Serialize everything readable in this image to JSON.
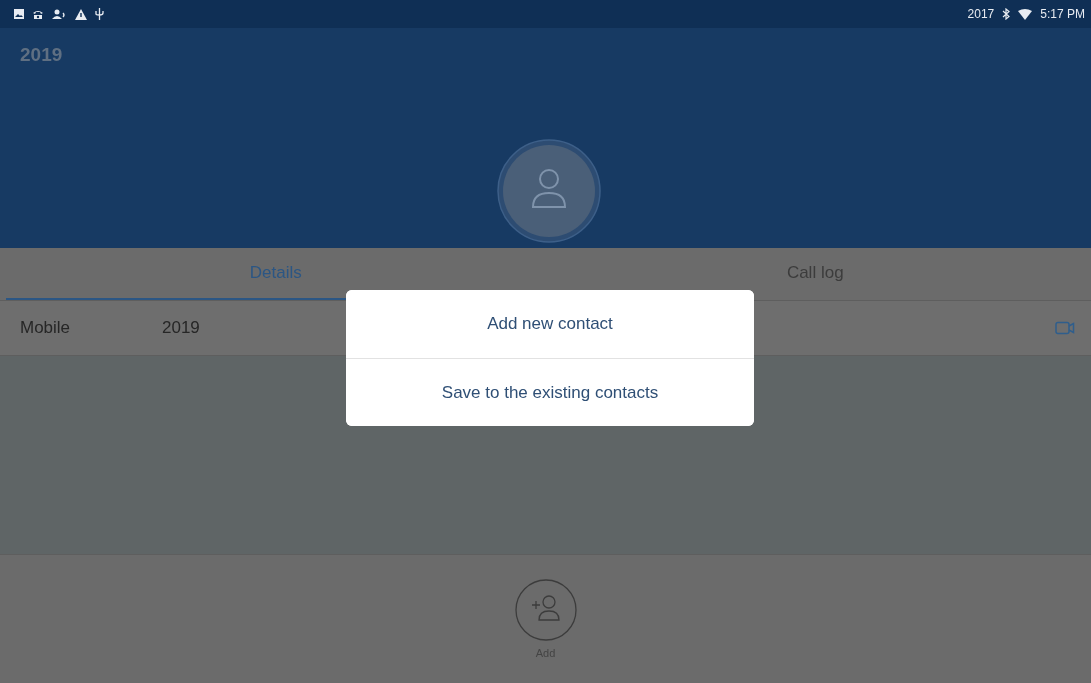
{
  "status_bar": {
    "left_text": "2017",
    "time": "5:17 PM"
  },
  "header": {
    "title": "2019"
  },
  "tabs": [
    {
      "label": "Details",
      "selected": true
    },
    {
      "label": "Call log",
      "selected": false
    }
  ],
  "details": [
    {
      "label": "Mobile",
      "value": "2019"
    }
  ],
  "bottom_bar": {
    "add_label": "Add"
  },
  "dialog": {
    "options": [
      "Add new contact",
      "Save to the existing contacts"
    ]
  }
}
